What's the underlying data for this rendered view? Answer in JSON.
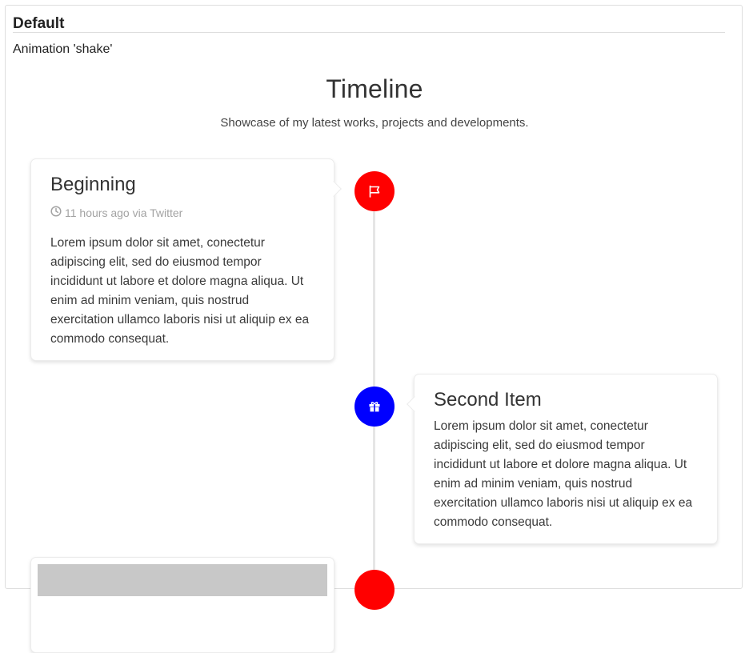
{
  "panel": {
    "title": "Default",
    "subtitle": "Animation 'shake'"
  },
  "timeline": {
    "title": "Timeline",
    "description": "Showcase of my latest works, projects and developments.",
    "items": [
      {
        "title": "Beginning",
        "meta": "11 hours ago via Twitter",
        "body": "Lorem ipsum dolor sit amet, conectetur adipiscing elit, sed do eiusmod tempor incididunt ut labore et dolore magna aliqua. Ut enim ad minim veniam, quis nostrud exercitation ullamco laboris nisi ut aliquip ex ea commodo consequat.",
        "icon": "flag-icon",
        "color": "#ff0000"
      },
      {
        "title": "Second Item",
        "body": "Lorem ipsum dolor sit amet, conectetur adipiscing elit, sed do eiusmod tempor incididunt ut labore et dolore magna aliqua. Ut enim ad minim veniam, quis nostrud exercitation ullamco laboris nisi ut aliquip ex ea commodo consequat.",
        "icon": "gift-icon",
        "color": "#0000ff"
      },
      {
        "icon": "marker",
        "color": "#ff0000"
      }
    ]
  }
}
